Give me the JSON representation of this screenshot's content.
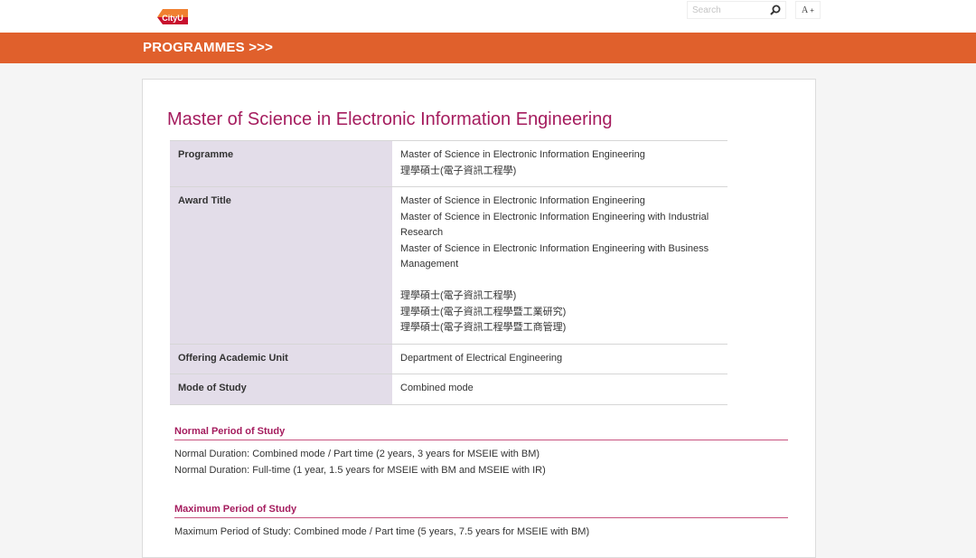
{
  "header": {
    "logo_text": "CityU",
    "search_placeholder": "Search",
    "font_size_label": "A",
    "font_size_plus": "+"
  },
  "nav": {
    "section_title": "PROGRAMMES >>>"
  },
  "page": {
    "title": "Master of Science in Electronic Information Engineering",
    "details": [
      {
        "label": "Programme",
        "lines": [
          "Master of Science in Electronic Information Engineering",
          "理學碩士(電子資訊工程學)"
        ]
      },
      {
        "label": "Award Title",
        "lines": [
          "Master of Science in Electronic Information Engineering",
          "Master of Science in Electronic Information Engineering with Industrial",
          "Research",
          "Master of Science in Electronic Information Engineering with Business",
          "Management",
          "",
          "理學碩士(電子資訊工程學)",
          "理學碩士(電子資訊工程學暨工業研究)",
          "理學碩士(電子資訊工程學暨工商管理)"
        ]
      },
      {
        "label": "Offering Academic Unit",
        "lines": [
          "Department of Electrical Engineering"
        ]
      },
      {
        "label": "Mode of Study",
        "lines": [
          "Combined mode"
        ]
      }
    ],
    "normal_period": {
      "heading": "Normal Period of Study",
      "lines": [
        "Normal Duration: Combined mode / Part time (2 years, 3 years for MSEIE with BM)",
        "Normal Duration: Full-time (1 year, 1.5 years for MSEIE with BM and MSEIE with IR)"
      ]
    },
    "maximum_period": {
      "heading": "Maximum Period of Study",
      "lines": [
        "Maximum Period of Study: Combined mode / Part time (5 years, 7.5 years for MSEIE with BM)"
      ]
    }
  },
  "colors": {
    "accent_orange": "#e0602c",
    "title_magenta": "#a51c5e",
    "label_cell_bg": "#e3dde9"
  }
}
